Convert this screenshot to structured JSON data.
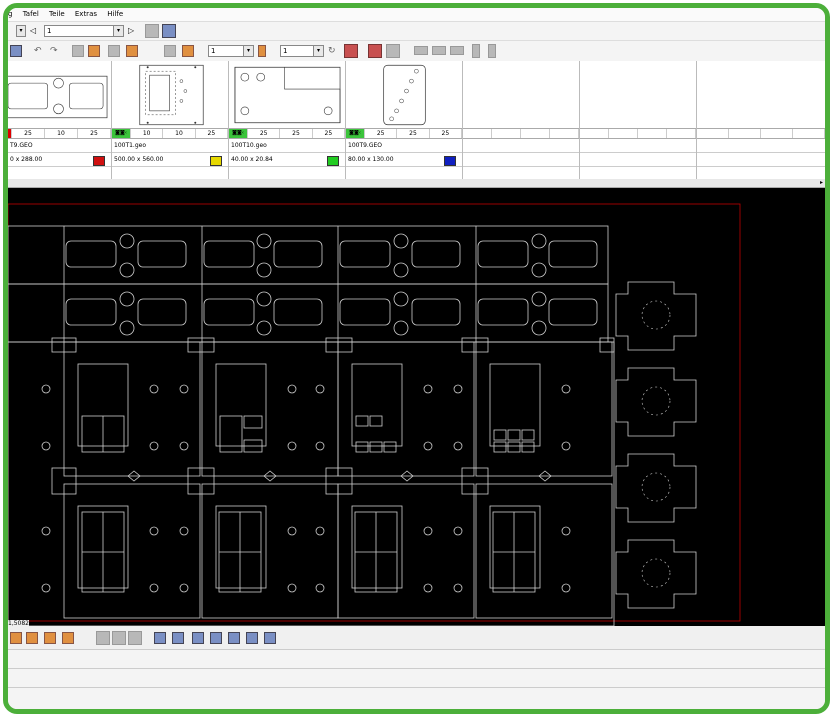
{
  "menu": [
    "g",
    "Tafel",
    "Teile",
    "Extras",
    "Hilfe"
  ],
  "toolbar1": {
    "page_value": "1"
  },
  "toolbar2": {
    "combo_a": "1",
    "combo_b": "1"
  },
  "tiles": [
    {
      "qty": [
        "25",
        "10",
        "25"
      ],
      "name": "T9.GEO",
      "dims": "0 x 288.00",
      "color": "#d01010",
      "marker": "",
      "partial": true
    },
    {
      "qty": [
        "10",
        "10",
        "25"
      ],
      "name": "100T1.geo",
      "dims": "500.00 x 560.00",
      "color": "#e6d800",
      "marker": "◙◙‹"
    },
    {
      "qty": [
        "25",
        "25",
        "25"
      ],
      "name": "100T10.geo",
      "dims": "40.00 x 20.84",
      "color": "#22cc22",
      "marker": "◙◙‹"
    },
    {
      "qty": [
        "25",
        "25",
        "25"
      ],
      "name": "100T9.GEO",
      "dims": "80.00 x 130.00",
      "color": "#1020c0",
      "marker": "◙◙‹"
    },
    {
      "qty": [
        "",
        "",
        ""
      ],
      "name": "",
      "dims": "",
      "color": "",
      "marker": ""
    },
    {
      "qty": [
        "",
        "",
        ""
      ],
      "name": "",
      "dims": "",
      "color": "",
      "marker": ""
    },
    {
      "qty": [
        "",
        "",
        ""
      ],
      "name": "",
      "dims": "",
      "color": "",
      "marker": ""
    }
  ],
  "status": {
    "coord": "1,5082"
  },
  "colors": {
    "frame": "#4caf3a",
    "canvas": "#000000",
    "sheet_border": "#c00000",
    "part_line": "#cfcfcf"
  }
}
